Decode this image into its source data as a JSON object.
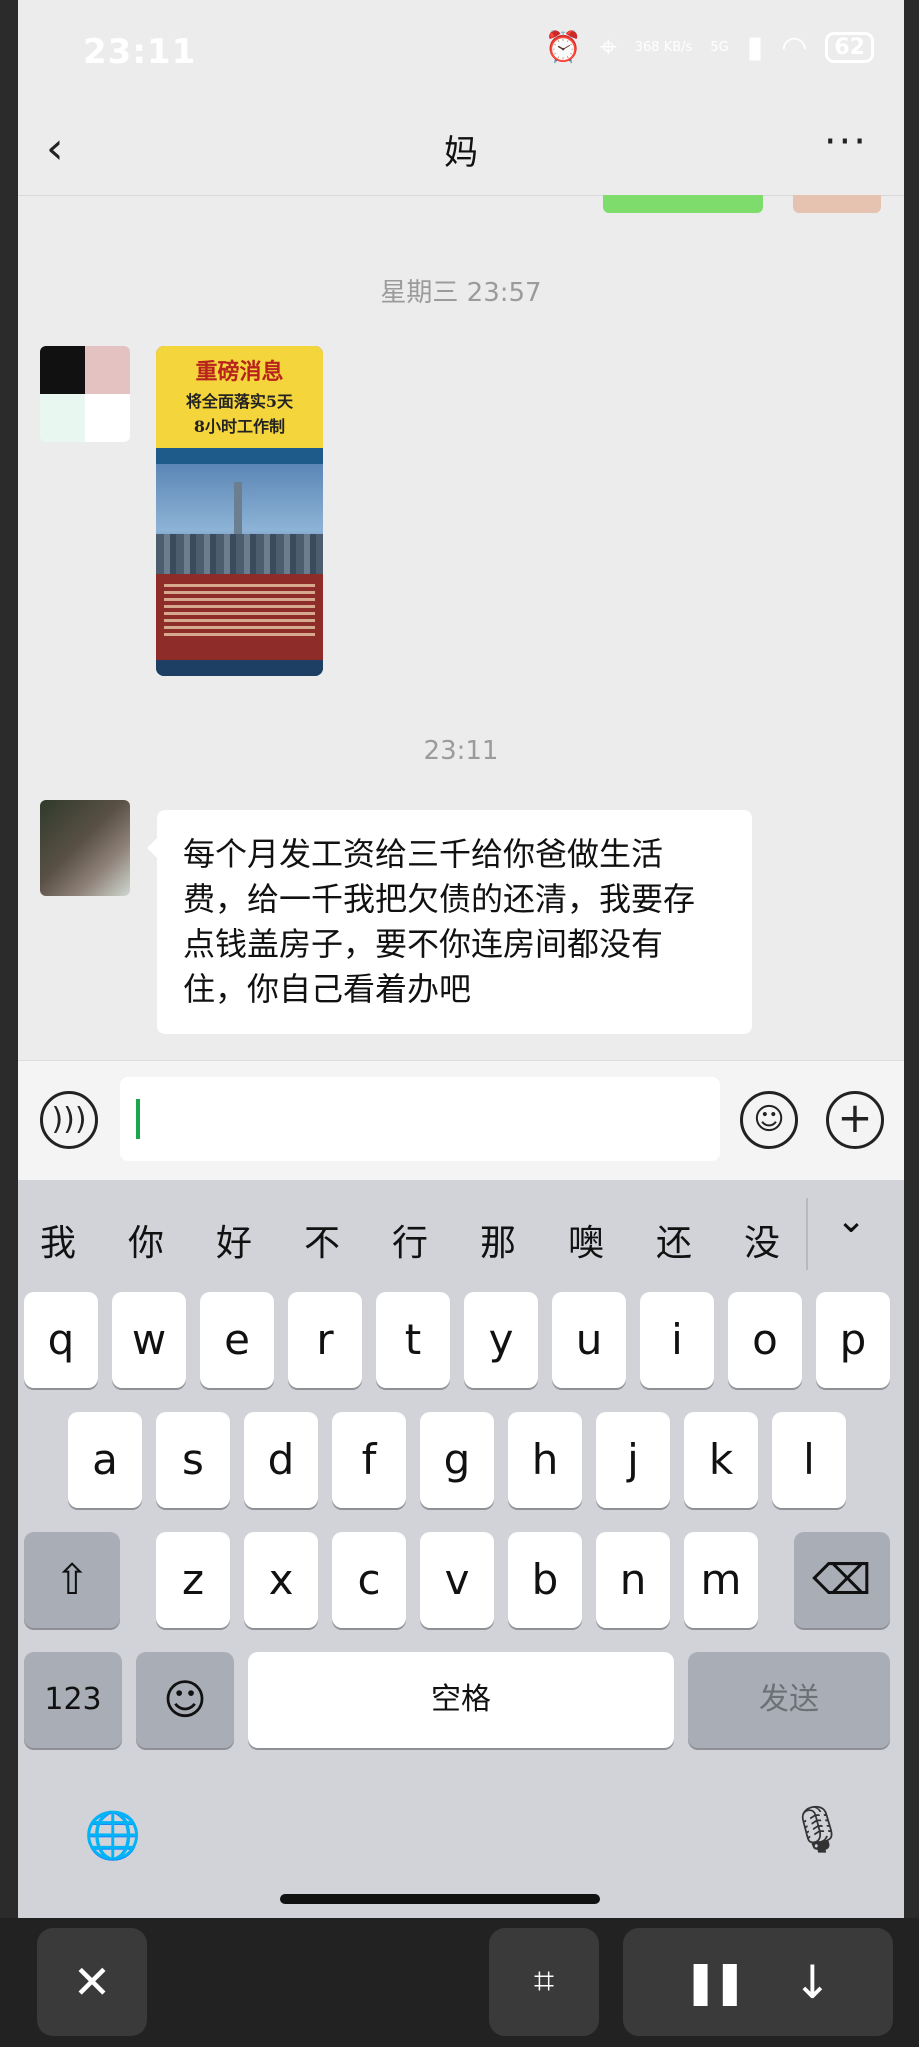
{
  "status_bar": {
    "time": "23:11",
    "network": "368 KB/s",
    "signal": "5G",
    "battery": "62"
  },
  "nav": {
    "back_icon": "‹",
    "title": "妈",
    "more_icon": "···"
  },
  "chat": {
    "timestamp_1": "星期三 23:57",
    "image_message": {
      "headline": "重磅消息",
      "subhead_1": "将全面落实5天",
      "subhead_2": "8小时工作制"
    },
    "timestamp_2": "23:11",
    "text_message": "每个月发工资给三千给你爸做生活费，给一千我把欠债的还清，我要存点钱盖房子，要不你连房间都没有住，你自己看着办吧"
  },
  "input_bar": {
    "voice_icon": "voice-icon",
    "emoji_icon": "emoji-icon",
    "plus_icon": "plus-icon",
    "text_value": ""
  },
  "keyboard": {
    "suggestions": [
      "我",
      "你",
      "好",
      "不",
      "行",
      "那",
      "噢",
      "还",
      "没"
    ],
    "collapse_icon": "⌄",
    "row1": [
      "q",
      "w",
      "e",
      "r",
      "t",
      "y",
      "u",
      "i",
      "o",
      "p"
    ],
    "row2": [
      "a",
      "s",
      "d",
      "f",
      "g",
      "h",
      "j",
      "k",
      "l"
    ],
    "row3": [
      "z",
      "x",
      "c",
      "v",
      "b",
      "n",
      "m"
    ],
    "shift_icon": "⇧",
    "delete_icon": "⌫",
    "numbers_key": "123",
    "emoji_key": "☺",
    "space_key": "空格",
    "send_key": "发送",
    "globe_icon": "🌐",
    "mic_icon": "🎙"
  },
  "overlay": {
    "close_icon": "✕",
    "scan_icon": "⌗",
    "pause_icon": "❚❚",
    "down_icon": "↓"
  }
}
